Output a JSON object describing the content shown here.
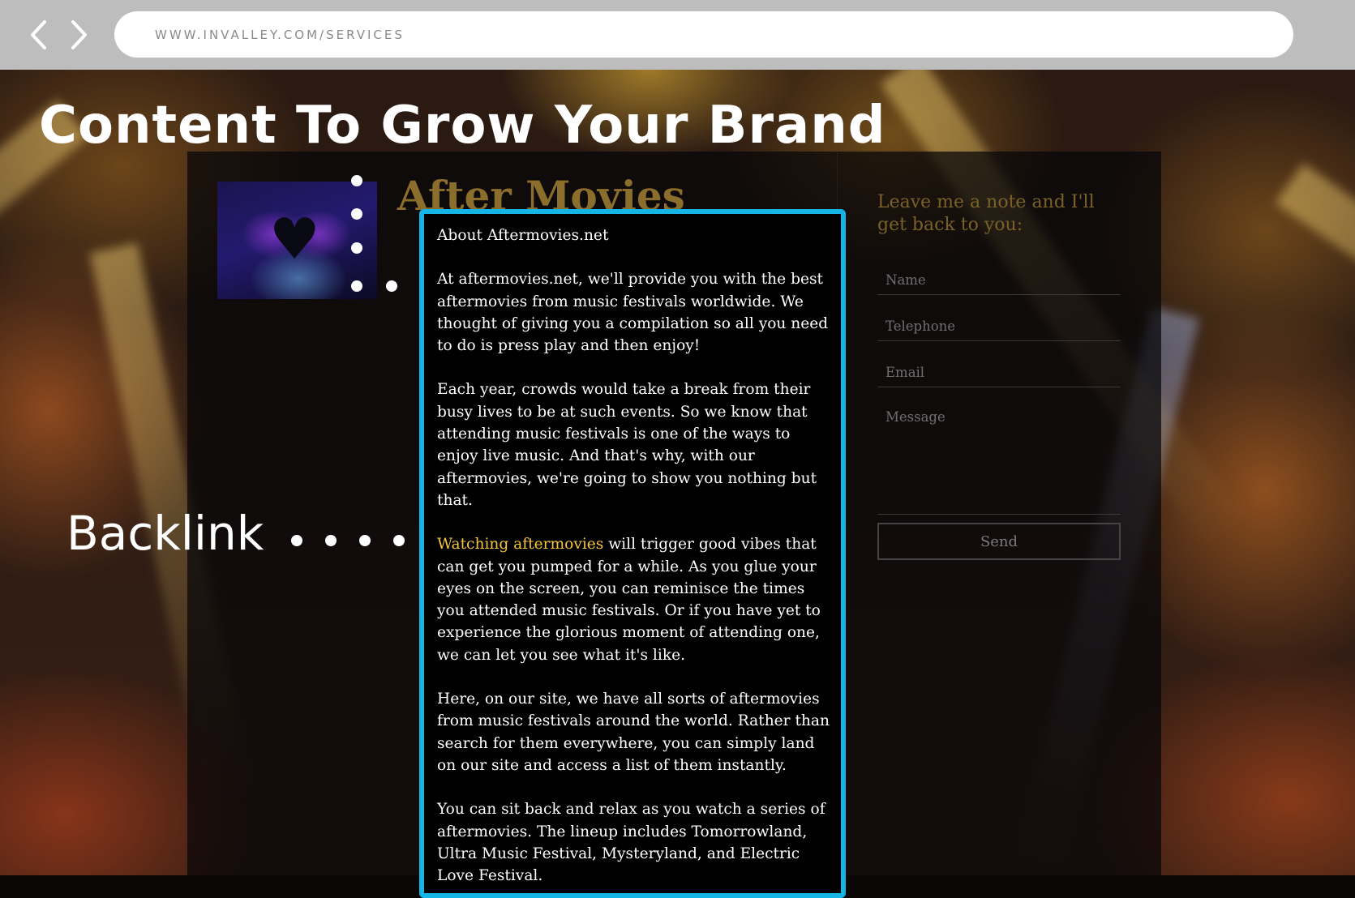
{
  "browser": {
    "url": "WWW.INVALLEY.COM/SERVICES",
    "back_icon": "chevron-left-icon",
    "forward_icon": "chevron-right-icon"
  },
  "page_title": "Content To Grow Your Brand",
  "site": {
    "logo_text": "After Movies"
  },
  "article": {
    "heading": "About Aftermovies.net",
    "paragraph_1": "At aftermovies.net, we'll provide you with the best aftermovies from music festivals worldwide. We thought of giving you a compilation so all you need to do is press play and then enjoy!",
    "paragraph_2": "Each year, crowds would take a break from their busy lives to be at such events. So we know that attending music festivals is one of the ways to enjoy live music. And that's why, with our aftermovies, we're going to show you nothing but that.",
    "backlink_text": "Watching aftermovies",
    "paragraph_3_rest": " will trigger good vibes that can get you pumped for a while. As you glue your eyes on the screen, you can reminisce the times you attended music festivals. Or if you have yet to experience the glorious moment of attending one, we can let you see what it's like.",
    "paragraph_4": "Here, on our site, we have all sorts of aftermovies from music festivals around the world. Rather than search for them everywhere, you can simply land on our site and access a list of them instantly.",
    "paragraph_5": "You can sit back and relax as you watch a series of aftermovies. The lineup includes Tomorrowland, Ultra Music Festival, Mysteryland, and Electric Love Festival."
  },
  "callout": {
    "label": "Backlink"
  },
  "contact": {
    "heading": "Leave me a note and I'll get back to you:",
    "name_placeholder": "Name",
    "telephone_placeholder": "Telephone",
    "email_placeholder": "Email",
    "message_placeholder": "Message",
    "send_label": "Send"
  },
  "colors": {
    "highlight_border": "#15b6e6",
    "backlink_text": "#f5c540",
    "logo_gold": "#8c6e2c"
  }
}
